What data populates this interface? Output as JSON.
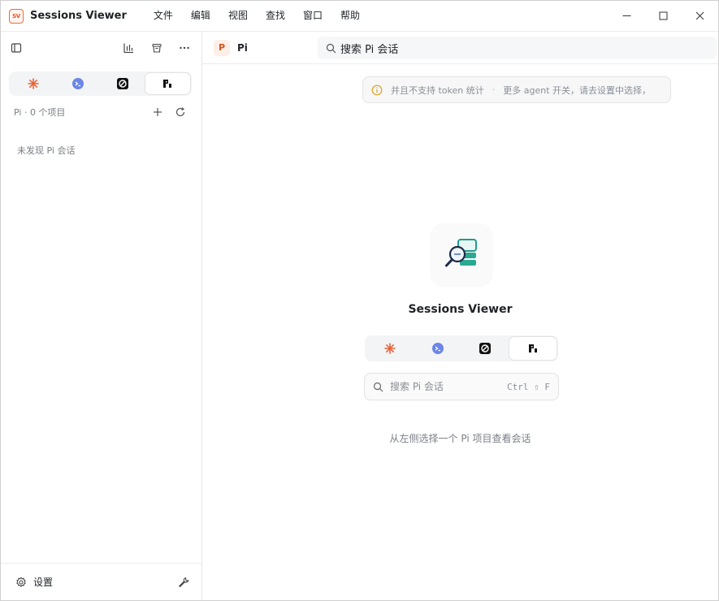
{
  "app": {
    "logo_text": "SV",
    "title": "Sessions Viewer",
    "accent_color": "#e0522a"
  },
  "menu": [
    "文件",
    "编辑",
    "视图",
    "查找",
    "窗口",
    "帮助"
  ],
  "window_controls": [
    "minimize-icon",
    "maximize-icon",
    "close-icon"
  ],
  "sidebar": {
    "toolbar_icons": [
      "sidebar-toggle-icon",
      "stats-chart-icon",
      "trash-icon",
      "more-icon"
    ],
    "agent_tabs": [
      {
        "name": "claude",
        "icon": "asterisk-icon",
        "active": false
      },
      {
        "name": "gemini",
        "icon": "gemini-icon",
        "active": false
      },
      {
        "name": "codex",
        "icon": "codex-icon",
        "active": false
      },
      {
        "name": "pi",
        "icon": "pi-icon",
        "active": true
      }
    ],
    "project_count": "Pi · 0 个项目",
    "empty_message": "未发现 Pi 会话",
    "settings_label": "设置"
  },
  "main": {
    "agent_chip": "P",
    "agent_title": "Pi",
    "search_value": "搜索 Pi 会话",
    "notice_part1": "并且不支持 token 统计",
    "notice_sep": "·",
    "notice_part2": "更多 agent 开关，请去设置中选择，",
    "hero_title": "Sessions Viewer",
    "hero_search_placeholder": "搜索 Pi 会话",
    "shortcut": "Ctrl ⇧ F",
    "hint": "从左侧选择一个 Pi 项目查看会话"
  }
}
